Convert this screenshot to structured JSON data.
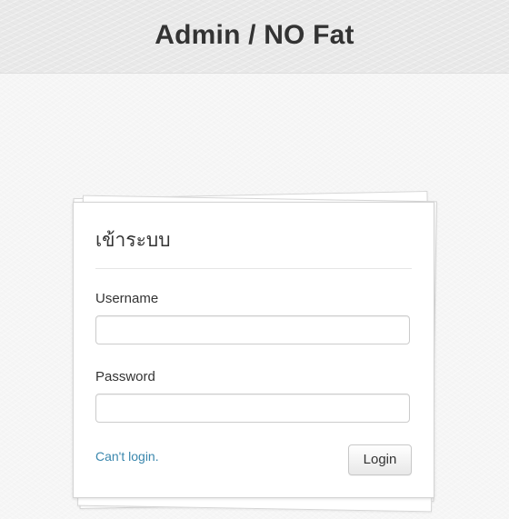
{
  "header": {
    "title": "Admin / NO Fat"
  },
  "login_card": {
    "title": "เข้าระบบ",
    "username_label": "Username",
    "username_value": "",
    "password_label": "Password",
    "password_value": "",
    "forgot_link": "Can't login.",
    "login_button": "Login"
  },
  "colors": {
    "link": "#3a87ad",
    "header_background": "#e9e9e9",
    "page_background": "#f6f6f6",
    "text": "#333333"
  }
}
